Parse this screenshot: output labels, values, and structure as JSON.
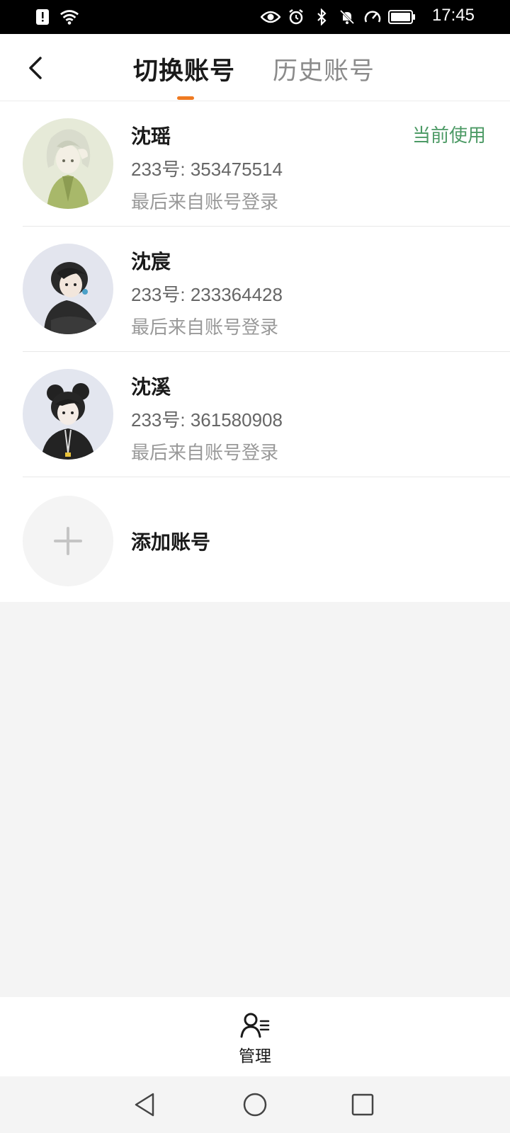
{
  "status_bar": {
    "time": "17:45",
    "icons": [
      "sim-alert-icon",
      "wifi-icon",
      "eye-icon",
      "alarm-icon",
      "bluetooth-icon",
      "mute-icon",
      "speed-icon",
      "battery-icon"
    ]
  },
  "header": {
    "tabs": [
      {
        "label": "切换账号",
        "active": true
      },
      {
        "label": "历史账号",
        "active": false
      }
    ],
    "accent_color": "#ef7a21"
  },
  "accounts": [
    {
      "name": "沈瑶",
      "uid": "233号: 353475514",
      "last_login": "最后来自账号登录",
      "badge": "当前使用"
    },
    {
      "name": "沈宸",
      "uid": "233号: 233364428",
      "last_login": "最后来自账号登录",
      "badge": ""
    },
    {
      "name": "沈溪",
      "uid": "233号: 361580908",
      "last_login": "最后来自账号登录",
      "badge": ""
    }
  ],
  "add_account": {
    "label": "添加账号"
  },
  "bottom_bar": {
    "manage_label": "管理"
  },
  "colors": {
    "current_badge": "#4c9a65",
    "background": "#f4f4f4"
  }
}
